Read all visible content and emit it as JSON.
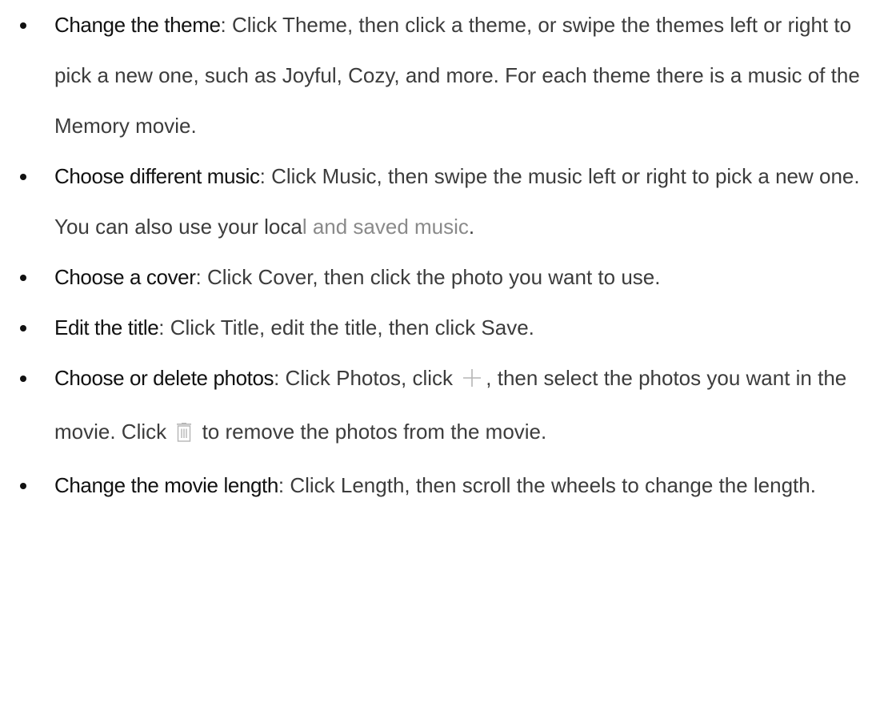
{
  "items": [
    {
      "term": "Change the theme",
      "text": ": Click Theme, then click a theme, or swipe the themes left or right to pick a new one, such as Joyful, Cozy, and more. For each theme there is a music of the Memory movie."
    },
    {
      "term": "Choose different music",
      "text": ": Click Music, then swipe the music left or right to pick a new one. You can also use your loca",
      "text_muted": "l and saved music",
      "text_end": "."
    },
    {
      "term": "Choose a cover",
      "text": ": Click Cover, then click the photo you want to use."
    },
    {
      "term": "Edit the title",
      "text": ": Click Title, edit the title, then click Save."
    },
    {
      "term": "Choose or delete photos",
      "text_a": ": Click Photos, click ",
      "icon_a": "plus-icon",
      "text_b": ", then select the photos you want in the movie. Click ",
      "icon_b": "trash-icon",
      "text_c": " to remove the photos from the movie."
    },
    {
      "term": "Change the movie length",
      "text": ": Click Length, then scroll the wheels to change the length."
    }
  ]
}
